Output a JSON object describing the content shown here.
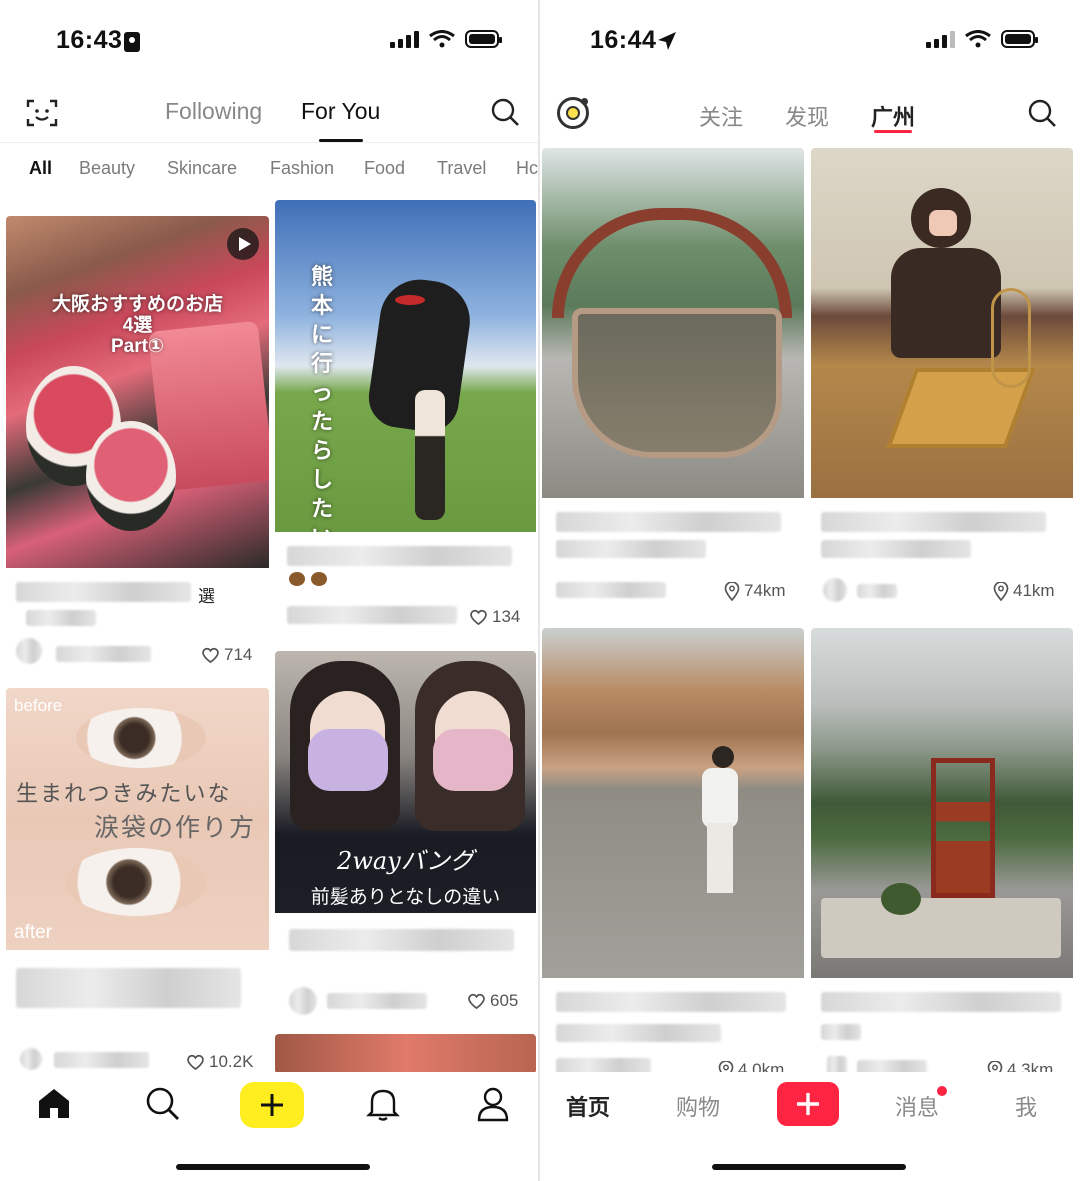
{
  "left": {
    "status": {
      "time": "16:43"
    },
    "top_tabs": {
      "following": "Following",
      "for_you": "For You"
    },
    "categories": [
      "All",
      "Beauty",
      "Skincare",
      "Fashion",
      "Food",
      "Travel",
      "Hc"
    ],
    "cards": [
      {
        "overlay_line1": "大阪おすすめのお店",
        "overlay_line2": "4選",
        "overlay_line3": "Part①",
        "title_tail": "選",
        "likes": "714"
      },
      {
        "overlay": "熊本に行ったらしたいこと",
        "likes": "134"
      },
      {
        "overlay_before": "before",
        "overlay_main1": "生まれつきみたいな",
        "overlay_main2": "涙袋の作り方",
        "overlay_after": "after",
        "likes": "10.2K"
      },
      {
        "overlay_line1": "2wayバング",
        "overlay_line2": "前髪ありとなしの違い",
        "likes": "605"
      }
    ]
  },
  "right": {
    "status": {
      "time": "16:44"
    },
    "tabs": {
      "follow": "关注",
      "discover": "发现",
      "city": "广州"
    },
    "cards": [
      {
        "distance": "74km"
      },
      {
        "distance": "41km"
      },
      {
        "distance": "4.0km"
      },
      {
        "distance": "4.3km"
      }
    ],
    "nav": {
      "home": "首页",
      "shop": "购物",
      "messages": "消息",
      "me": "我"
    }
  },
  "colors": {
    "for_you_plus": "#ffee1f",
    "rednote_red": "#ff2442"
  }
}
